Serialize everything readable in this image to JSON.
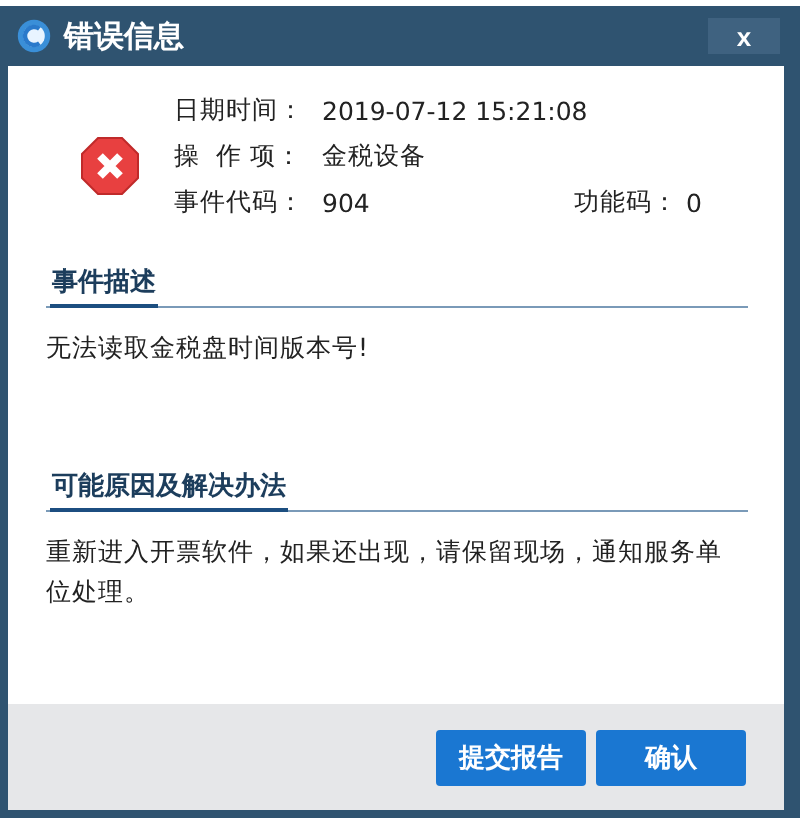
{
  "window": {
    "title": "错误信息",
    "close": "x"
  },
  "info": [
    {
      "label": "日期时间：",
      "value": "2019-07-12 15:21:08"
    },
    {
      "label": "操  作 项：",
      "value": "金税设备"
    },
    {
      "label": "事件代码：",
      "value": "904",
      "extra_label": "功能码：",
      "extra_value": "0"
    }
  ],
  "sections": [
    {
      "heading": "事件描述",
      "text": "无法读取金税盘时间版本号!"
    },
    {
      "heading": "可能原因及解决办法",
      "text": "重新进入开票软件，如果还出现，请保留现场，通知服务单位处理。"
    }
  ],
  "buttons": [
    "提交报告",
    "确认"
  ]
}
